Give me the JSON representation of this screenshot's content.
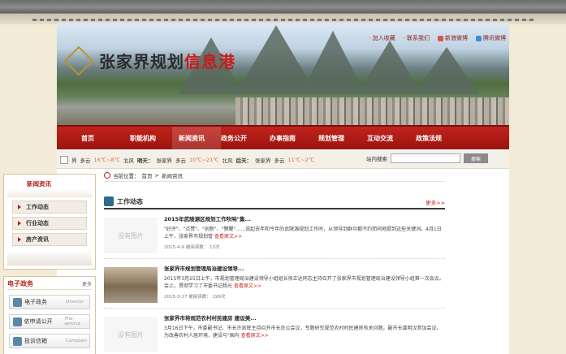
{
  "header": {
    "logo_text": "张家界规划",
    "logo_highlight": "信息港",
    "links": [
      "加入收藏",
      "联系我们",
      "新浪微博",
      "腾讯微博"
    ]
  },
  "nav": {
    "items": [
      "首页",
      "职能机构",
      "新闻资讯",
      "政务公开",
      "办事指南",
      "规划管理",
      "互动交流",
      "政策法规"
    ],
    "active": "新闻资讯"
  },
  "weather": {
    "today_city": "界",
    "today_weather": "多云",
    "today_temp": "16℃~8℃",
    "today_wind": "北风",
    "tomorrow_label": "明天：",
    "tomorrow_city": "张家界",
    "tomorrow_weather": "多云",
    "tomorrow_temp": "10℃~21℃",
    "tomorrow_wind": "北风",
    "after_label": "后天：",
    "after_city": "张家界",
    "after_weather": "多云",
    "after_temp": "11℃~2℃",
    "search_label": "站内搜索",
    "search_button": "搜索"
  },
  "sidebar": {
    "title": "新闻资讯",
    "items": [
      "工作动态",
      "行业动态",
      "房产资讯"
    ]
  },
  "gov": {
    "title": "电子政务",
    "more": "更多",
    "items": [
      {
        "label": "电子政务",
        "en": "Director"
      },
      {
        "label": "依申请公开",
        "en": "The service"
      },
      {
        "label": "投诉信箱",
        "en": "Complain"
      }
    ]
  },
  "main": {
    "crumb_prefix": "当前位置：",
    "crumb_home": "首页",
    "crumb_sep": ">",
    "crumb_current": "新闻资讯",
    "section_title": "工作动态",
    "more": "更多>>",
    "news": [
      {
        "thumb": "没有图片",
        "title": "2015年武陵源区规划工作吹响\"集...",
        "summary": "\"好评\"、\"点赞\"、\"创新\"、\"警醒\"……说起去年和今年的武陵源规划工作时，从领导到群众都不约而同地提到这些关键词。4月1日上午，张家界市规划管",
        "readmore": "查看原文>>",
        "meta": "2015-4-9  被阅读数：  13次"
      },
      {
        "thumb": "",
        "title": "张家界市规划管理局治建设领导...",
        "summary": "2015年3月25日上午，市规划管理局治建设领导小组组长徐正达同志主持召开了张家界市规划管理局治建设领导小组第一次会议。会上，贯彻学习了市委书记杨光",
        "readmore": "查看原文>>",
        "meta": "2015-3-27  被阅读数：  199次"
      },
      {
        "thumb": "没有图片",
        "title": "张家界市将规范农村村民建房  建设美...",
        "summary": "3月16日下午，市委副书记、市长许显辉主持召开市长办公会议，专题研究规范农村村民建房有关问题。副市长龚明汉参加会议。为改善农村人居环境，建设与\"国内",
        "readmore": "查看原文>>",
        "meta": ""
      }
    ]
  },
  "colors": {
    "nav_red": "#c0231c",
    "accent_red": "#b3241b",
    "page_bg": "#f3ead8"
  }
}
